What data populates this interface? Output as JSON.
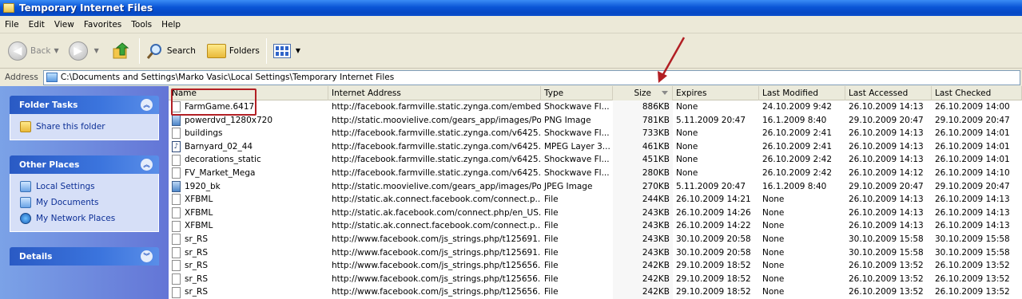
{
  "window": {
    "title": "Temporary Internet Files"
  },
  "menu": [
    "File",
    "Edit",
    "View",
    "Favorites",
    "Tools",
    "Help"
  ],
  "toolbar": {
    "back": "Back",
    "search": "Search",
    "folders": "Folders"
  },
  "address": {
    "label": "Address",
    "path": "C:\\Documents and Settings\\Marko Vasic\\Local Settings\\Temporary Internet Files"
  },
  "sidebar": {
    "folder_tasks": {
      "title": "Folder Tasks",
      "items": [
        "Share this folder"
      ]
    },
    "other_places": {
      "title": "Other Places",
      "items": [
        "Local Settings",
        "My Documents",
        "My Network Places"
      ]
    },
    "details": {
      "title": "Details"
    }
  },
  "columns": [
    "Name",
    "Internet Address",
    "Type",
    "Size",
    "Expires",
    "Last Modified",
    "Last Accessed",
    "Last Checked"
  ],
  "files": [
    {
      "name": "FarmGame.6417",
      "icon": "blank-file-icon",
      "address": "http://facebook.farmville.static.zynga.com/embed...",
      "type": "Shockwave Fl...",
      "size": "886KB",
      "expires": "None",
      "modified": "24.10.2009 9:42",
      "accessed": "26.10.2009 14:13",
      "checked": "26.10.2009 14:00"
    },
    {
      "name": "powerdvd_1280x720",
      "icon": "image-file-icon",
      "address": "http://static.moovielive.com/gears_app/images/Po...",
      "type": "PNG Image",
      "size": "781KB",
      "expires": "5.11.2009 20:47",
      "modified": "16.1.2009 8:40",
      "accessed": "29.10.2009 20:47",
      "checked": "29.10.2009 20:47"
    },
    {
      "name": "buildings",
      "icon": "blank-file-icon",
      "address": "http://facebook.farmville.static.zynga.com/v6425...",
      "type": "Shockwave Fl...",
      "size": "733KB",
      "expires": "None",
      "modified": "26.10.2009 2:41",
      "accessed": "26.10.2009 14:13",
      "checked": "26.10.2009 14:01"
    },
    {
      "name": "Barnyard_02_44",
      "icon": "audio-file-icon",
      "address": "http://facebook.farmville.static.zynga.com/v6425...",
      "type": "MPEG Layer 3...",
      "size": "461KB",
      "expires": "None",
      "modified": "26.10.2009 2:41",
      "accessed": "26.10.2009 14:13",
      "checked": "26.10.2009 14:01"
    },
    {
      "name": "decorations_static",
      "icon": "blank-file-icon",
      "address": "http://facebook.farmville.static.zynga.com/v6425...",
      "type": "Shockwave Fl...",
      "size": "451KB",
      "expires": "None",
      "modified": "26.10.2009 2:42",
      "accessed": "26.10.2009 14:13",
      "checked": "26.10.2009 14:01"
    },
    {
      "name": "FV_Market_Mega",
      "icon": "blank-file-icon",
      "address": "http://facebook.farmville.static.zynga.com/v6425...",
      "type": "Shockwave Fl...",
      "size": "280KB",
      "expires": "None",
      "modified": "26.10.2009 2:42",
      "accessed": "26.10.2009 14:12",
      "checked": "26.10.2009 14:10"
    },
    {
      "name": "1920_bk",
      "icon": "image-file-icon",
      "address": "http://static.moovielive.com/gears_app/images/Po...",
      "type": "JPEG Image",
      "size": "270KB",
      "expires": "5.11.2009 20:47",
      "modified": "16.1.2009 8:40",
      "accessed": "29.10.2009 20:47",
      "checked": "29.10.2009 20:47"
    },
    {
      "name": "XFBML",
      "icon": "blank-file-icon",
      "address": "http://static.ak.connect.facebook.com/connect.p...",
      "type": "File",
      "size": "244KB",
      "expires": "26.10.2009 14:21",
      "modified": "None",
      "accessed": "26.10.2009 14:13",
      "checked": "26.10.2009 14:13"
    },
    {
      "name": "XFBML",
      "icon": "blank-file-icon",
      "address": "http://static.ak.facebook.com/connect.php/en_US...",
      "type": "File",
      "size": "243KB",
      "expires": "26.10.2009 14:26",
      "modified": "None",
      "accessed": "26.10.2009 14:13",
      "checked": "26.10.2009 14:13"
    },
    {
      "name": "XFBML",
      "icon": "blank-file-icon",
      "address": "http://static.ak.connect.facebook.com/connect.p...",
      "type": "File",
      "size": "243KB",
      "expires": "26.10.2009 14:22",
      "modified": "None",
      "accessed": "26.10.2009 14:13",
      "checked": "26.10.2009 14:13"
    },
    {
      "name": "sr_RS",
      "icon": "blank-file-icon",
      "address": "http://www.facebook.com/js_strings.php/t125691...",
      "type": "File",
      "size": "243KB",
      "expires": "30.10.2009 20:58",
      "modified": "None",
      "accessed": "30.10.2009 15:58",
      "checked": "30.10.2009 15:58"
    },
    {
      "name": "sr_RS",
      "icon": "blank-file-icon",
      "address": "http://www.facebook.com/js_strings.php/t125691...",
      "type": "File",
      "size": "243KB",
      "expires": "30.10.2009 20:58",
      "modified": "None",
      "accessed": "30.10.2009 15:58",
      "checked": "30.10.2009 15:58"
    },
    {
      "name": "sr_RS",
      "icon": "blank-file-icon",
      "address": "http://www.facebook.com/js_strings.php/t125656...",
      "type": "File",
      "size": "242KB",
      "expires": "29.10.2009 18:52",
      "modified": "None",
      "accessed": "26.10.2009 13:52",
      "checked": "26.10.2009 13:52"
    },
    {
      "name": "sr_RS",
      "icon": "blank-file-icon",
      "address": "http://www.facebook.com/js_strings.php/t125656...",
      "type": "File",
      "size": "242KB",
      "expires": "29.10.2009 18:52",
      "modified": "None",
      "accessed": "26.10.2009 13:52",
      "checked": "26.10.2009 13:52"
    },
    {
      "name": "sr_RS",
      "icon": "blank-file-icon",
      "address": "http://www.facebook.com/js_strings.php/t125656...",
      "type": "File",
      "size": "242KB",
      "expires": "29.10.2009 18:52",
      "modified": "None",
      "accessed": "26.10.2009 13:52",
      "checked": "26.10.2009 13:52"
    }
  ],
  "annotations": {
    "highlight_color": "#b21f24",
    "arrow_color": "#b21f24"
  }
}
